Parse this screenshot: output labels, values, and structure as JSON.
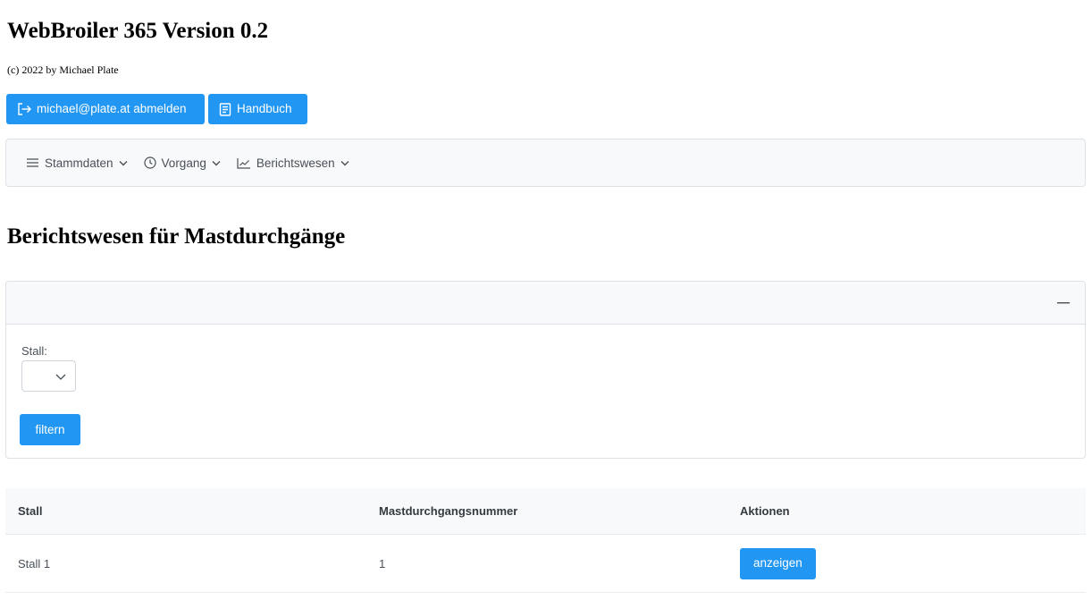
{
  "header": {
    "title": "WebBroiler 365 Version 0.2",
    "copyright": "(c) 2022 by Michael Plate"
  },
  "actions": {
    "logout_label": "michael@plate.at abmelden",
    "manual_label": "Handbuch"
  },
  "menu": {
    "items": [
      {
        "label": "Stammdaten",
        "icon": "bars-icon"
      },
      {
        "label": "Vorgang",
        "icon": "clock-icon"
      },
      {
        "label": "Berichtswesen",
        "icon": "chart-line-icon"
      }
    ]
  },
  "page": {
    "title": "Berichtswesen für Mastdurchgänge"
  },
  "filter": {
    "stall_label": "Stall:",
    "stall_value": "",
    "submit_label": "filtern"
  },
  "table": {
    "columns": [
      "Stall",
      "Mastdurchgangsnummer",
      "Aktionen"
    ],
    "rows": [
      {
        "stall": "Stall 1",
        "nummer": "1",
        "action_label": "anzeigen"
      }
    ]
  },
  "colors": {
    "primary": "#2196f3",
    "menubar_bg": "#f8f9fa",
    "border": "#dee2e6"
  }
}
